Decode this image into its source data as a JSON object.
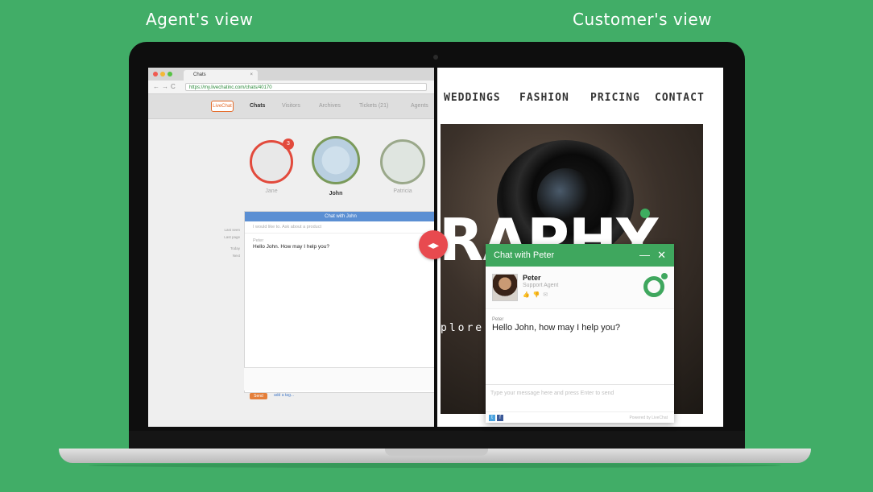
{
  "labels": {
    "agent_view": "Agent's view",
    "customer_view": "Customer's view"
  },
  "agent": {
    "tab_title": "Chats",
    "url": "https://my.livechatinc.com/chats/40170",
    "logo_text": "LiveChat",
    "nav": [
      "Chats",
      "Visitors",
      "Archives",
      "Tickets (21)",
      "Agents"
    ],
    "visitors": [
      {
        "name": "Jane",
        "badge": "3"
      },
      {
        "name": "John"
      },
      {
        "name": "Patricia"
      }
    ],
    "chat_header": "Chat with John",
    "system_message": "I would like to. Ask about a product",
    "message_author": "Peter",
    "message_text": "Hello John. How may I help you?",
    "side_labels": [
      "Last seen",
      "Last page",
      "Today",
      "Next"
    ],
    "tag_button": "Send",
    "add_tag": "add a tag..."
  },
  "customer": {
    "nav": [
      "WEDDINGS",
      "FASHION",
      "PRICING",
      "CONTACT"
    ],
    "hero_text": "RAPHY",
    "hero_sub": "plore",
    "widget": {
      "title": "Chat with Peter",
      "minimize": "—",
      "close": "✕",
      "agent_name": "Peter",
      "agent_role": "Support Agent",
      "message_author": "Peter",
      "message_text": "Hello John, how may I help you?",
      "input_placeholder": "Type your message here and press Enter to send",
      "powered_by": "Powered by LiveChat"
    }
  },
  "swap_icon": "arrows-icon",
  "colors": {
    "background": "#41ad67",
    "accent": "#3fa75e",
    "swap": "#e84a4f",
    "agent_chat_header": "#5b8fd3"
  }
}
